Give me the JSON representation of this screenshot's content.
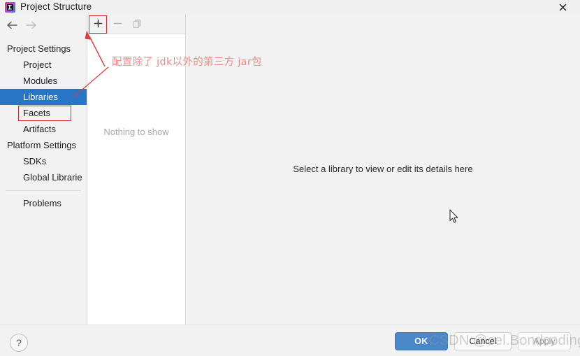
{
  "window": {
    "title": "Project Structure",
    "app_icon": "intellij-idea-icon",
    "close_label": "✕"
  },
  "navigation": {
    "back_icon": "arrow-left-icon",
    "forward_icon": "arrow-right-icon"
  },
  "sidebar": {
    "groups": [
      {
        "label": "Project Settings",
        "items": [
          {
            "label": "Project",
            "selected": false
          },
          {
            "label": "Modules",
            "selected": false
          },
          {
            "label": "Libraries",
            "selected": true
          },
          {
            "label": "Facets",
            "selected": false
          },
          {
            "label": "Artifacts",
            "selected": false
          }
        ]
      },
      {
        "label": "Platform Settings",
        "items": [
          {
            "label": "SDKs",
            "selected": false
          },
          {
            "label": "Global Librarie",
            "selected": false
          }
        ]
      }
    ],
    "footer_items": [
      {
        "label": "Problems",
        "selected": false
      }
    ]
  },
  "middle_panel": {
    "toolbar": {
      "add_label": "+",
      "add_icon": "plus-icon",
      "remove_label": "−",
      "remove_icon": "minus-icon",
      "copy_icon": "copy-icon"
    },
    "empty_message": "Nothing to show"
  },
  "detail_panel": {
    "message": "Select a library to view or edit its details here"
  },
  "annotations": {
    "note_text": "配置除了 jdk以外的第三方 jar包",
    "note_color": "#f08a8a",
    "highlight_color": "#d62b2b",
    "highlighted_targets": [
      "add-library-button",
      "sidebar-item-libraries"
    ]
  },
  "footer": {
    "help_label": "?",
    "help_icon": "question-mark-icon",
    "ok_label": "OK",
    "cancel_label": "Cancel",
    "apply_label": "Apply"
  },
  "watermark": {
    "text": "CSDN @cel.Bondcoding"
  },
  "colors": {
    "selection_blue": "#2775c4",
    "ok_button_blue": "#4a86c8",
    "annotation_red": "#d62b2b",
    "window_bg": "#f2f2f2"
  },
  "cursor": {
    "icon": "mouse-pointer-icon"
  }
}
